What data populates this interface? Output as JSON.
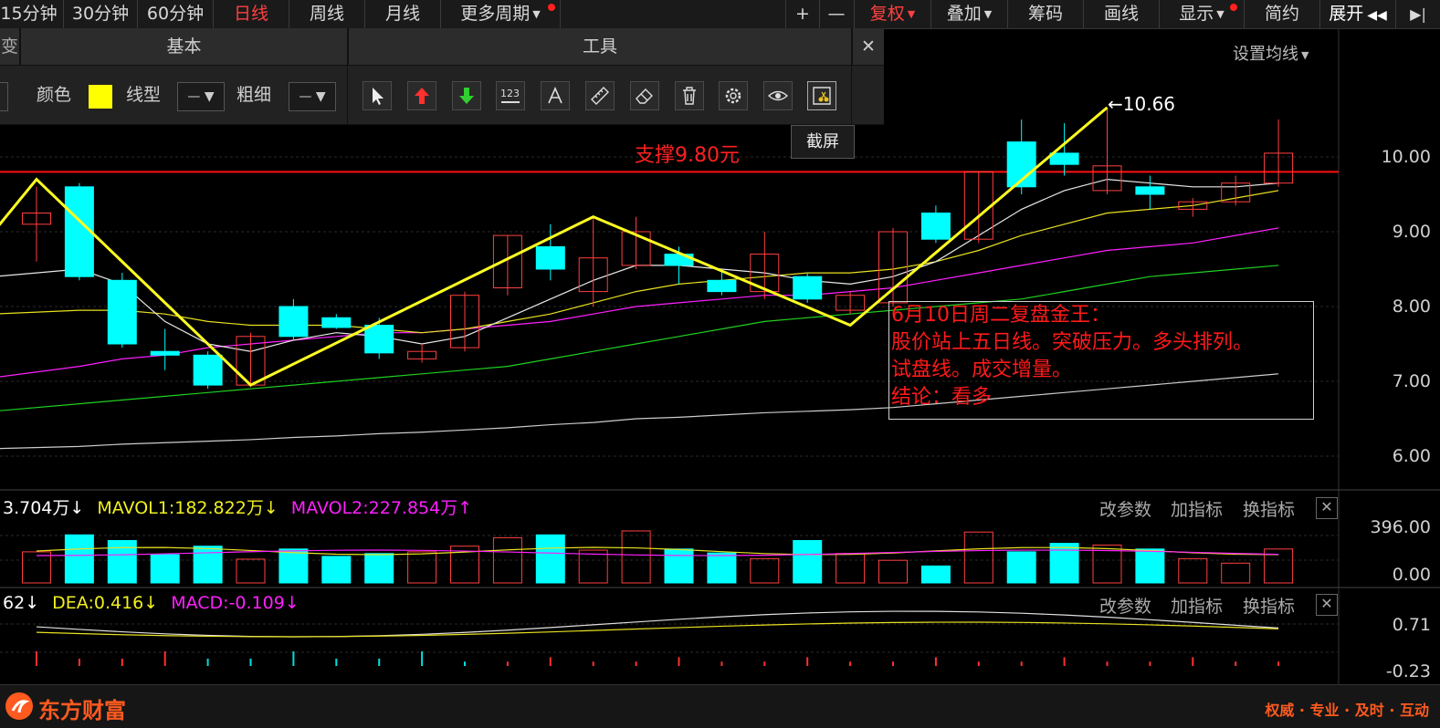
{
  "period_bar": {
    "items": [
      {
        "label": "15分钟",
        "active": false
      },
      {
        "label": "30分钟",
        "active": false
      },
      {
        "label": "60分钟",
        "active": false
      },
      {
        "label": "日线",
        "active": true
      },
      {
        "label": "周线",
        "active": false
      },
      {
        "label": "月线",
        "active": false
      },
      {
        "label": "更多周期",
        "active": false
      }
    ],
    "right_items": [
      {
        "label": "+"
      },
      {
        "label": "—"
      },
      {
        "label": "复权",
        "active": true
      },
      {
        "label": "叠加"
      },
      {
        "label": "筹码"
      },
      {
        "label": "画线"
      },
      {
        "label": "显示"
      },
      {
        "label": "简约"
      },
      {
        "label": "展开"
      }
    ]
  },
  "tool_panel": {
    "left_stub": "变",
    "section_basic": "基本",
    "section_tools": "工具",
    "color_label": "颜色",
    "linetype_label": "线型",
    "thickness_label": "粗细",
    "color_value": "#ffff00",
    "tools": [
      {
        "name": "pointer",
        "tip": ""
      },
      {
        "name": "up-arrow",
        "tip": ""
      },
      {
        "name": "down-arrow",
        "tip": ""
      },
      {
        "name": "number-123",
        "tip": ""
      },
      {
        "name": "text-a",
        "tip": ""
      },
      {
        "name": "ruler",
        "tip": ""
      },
      {
        "name": "eraser",
        "tip": ""
      },
      {
        "name": "trash",
        "tip": ""
      },
      {
        "name": "gear",
        "tip": ""
      },
      {
        "name": "eye",
        "tip": ""
      },
      {
        "name": "screenshot",
        "tip": "截屏"
      }
    ],
    "tooltip": "截屏",
    "close": "✕"
  },
  "main_chart": {
    "setting_label": "设置均线",
    "y_ticks": [
      "10.00",
      "9.00",
      "8.00",
      "7.00",
      "6.00"
    ],
    "support_label": "支撑9.80元",
    "high_label": "10.66",
    "note_lines": [
      "6月10日周二复盘金王：",
      "股价站上五日线。突破压力。多头排列。",
      "试盘线。成交增量。",
      "结论：看多"
    ],
    "colors": {
      "up": "#ff4040",
      "down": "#00ffff",
      "support": "#ff1010",
      "zigzag": "#ffff20"
    }
  },
  "chart_data": {
    "type": "candlestick",
    "y_range": [
      5.6,
      10.9
    ],
    "support_level": 9.8,
    "candles": [
      {
        "o": 9.1,
        "c": 9.25,
        "h": 9.6,
        "l": 8.6,
        "up": true
      },
      {
        "o": 9.6,
        "c": 8.4,
        "h": 9.65,
        "l": 8.35,
        "up": false
      },
      {
        "o": 8.35,
        "c": 7.5,
        "h": 8.45,
        "l": 7.45,
        "up": false
      },
      {
        "o": 7.4,
        "c": 7.35,
        "h": 7.7,
        "l": 7.15,
        "up": false
      },
      {
        "o": 7.35,
        "c": 6.95,
        "h": 7.4,
        "l": 6.9,
        "up": false
      },
      {
        "o": 6.95,
        "c": 7.6,
        "h": 7.65,
        "l": 6.92,
        "up": true
      },
      {
        "o": 8.0,
        "c": 7.6,
        "h": 8.1,
        "l": 7.55,
        "up": false
      },
      {
        "o": 7.85,
        "c": 7.72,
        "h": 7.9,
        "l": 7.7,
        "up": false
      },
      {
        "o": 7.75,
        "c": 7.38,
        "h": 7.85,
        "l": 7.3,
        "up": false
      },
      {
        "o": 7.3,
        "c": 7.4,
        "h": 7.5,
        "l": 7.25,
        "up": true
      },
      {
        "o": 7.45,
        "c": 8.15,
        "h": 8.2,
        "l": 7.4,
        "up": true
      },
      {
        "o": 8.25,
        "c": 8.95,
        "h": 8.95,
        "l": 8.15,
        "up": true
      },
      {
        "o": 8.8,
        "c": 8.5,
        "h": 9.1,
        "l": 8.35,
        "up": false
      },
      {
        "o": 8.2,
        "c": 8.65,
        "h": 9.2,
        "l": 8.0,
        "up": true
      },
      {
        "o": 8.55,
        "c": 9.0,
        "h": 9.2,
        "l": 8.5,
        "up": true
      },
      {
        "o": 8.7,
        "c": 8.55,
        "h": 8.8,
        "l": 8.3,
        "up": false
      },
      {
        "o": 8.35,
        "c": 8.2,
        "h": 8.5,
        "l": 8.15,
        "up": false
      },
      {
        "o": 8.2,
        "c": 8.7,
        "h": 9.0,
        "l": 8.1,
        "up": true
      },
      {
        "o": 8.4,
        "c": 8.1,
        "h": 8.45,
        "l": 8.05,
        "up": false
      },
      {
        "o": 7.95,
        "c": 8.15,
        "h": 8.2,
        "l": 7.9,
        "up": true
      },
      {
        "o": 8.05,
        "c": 9.0,
        "h": 9.05,
        "l": 8.0,
        "up": true
      },
      {
        "o": 9.25,
        "c": 8.9,
        "h": 9.35,
        "l": 8.85,
        "up": false
      },
      {
        "o": 8.9,
        "c": 9.8,
        "h": 9.8,
        "l": 8.85,
        "up": true
      },
      {
        "o": 10.2,
        "c": 9.6,
        "h": 10.5,
        "l": 9.5,
        "up": false
      },
      {
        "o": 10.05,
        "c": 9.9,
        "h": 10.45,
        "l": 9.75,
        "up": false
      },
      {
        "o": 9.55,
        "c": 9.88,
        "h": 10.66,
        "l": 9.5,
        "up": true
      },
      {
        "o": 9.6,
        "c": 9.5,
        "h": 9.75,
        "l": 9.3,
        "up": false
      },
      {
        "o": 9.4,
        "c": 9.3,
        "h": 9.45,
        "l": 9.2,
        "up": true
      },
      {
        "o": 9.4,
        "c": 9.65,
        "h": 9.75,
        "l": 9.35,
        "up": true
      },
      {
        "o": 9.65,
        "c": 10.05,
        "h": 10.5,
        "l": 9.6,
        "up": true
      }
    ],
    "zigzag": [
      [
        -1,
        9.0
      ],
      [
        0,
        9.7
      ],
      [
        5,
        6.95
      ],
      [
        13,
        9.2
      ],
      [
        19,
        7.75
      ],
      [
        25,
        10.66
      ]
    ],
    "ma_white": [
      8.4,
      8.5,
      8.3,
      7.8,
      7.5,
      7.4,
      7.55,
      7.65,
      7.6,
      7.5,
      7.6,
      7.85,
      8.1,
      8.35,
      8.55,
      8.55,
      8.5,
      8.45,
      8.35,
      8.3,
      8.4,
      8.6,
      8.95,
      9.3,
      9.55,
      9.7,
      9.65,
      9.6,
      9.6,
      9.65
    ],
    "ma_yellow": [
      7.9,
      7.95,
      7.95,
      7.9,
      7.8,
      7.75,
      7.75,
      7.75,
      7.7,
      7.65,
      7.7,
      7.8,
      7.9,
      8.05,
      8.2,
      8.3,
      8.35,
      8.4,
      8.45,
      8.45,
      8.5,
      8.6,
      8.75,
      8.95,
      9.1,
      9.25,
      9.3,
      9.35,
      9.45,
      9.55
    ],
    "ma_magenta": [
      7.05,
      7.2,
      7.3,
      7.35,
      7.45,
      7.5,
      7.55,
      7.6,
      7.65,
      7.65,
      7.7,
      7.75,
      7.8,
      7.9,
      8.0,
      8.05,
      8.1,
      8.15,
      8.15,
      8.2,
      8.25,
      8.35,
      8.45,
      8.55,
      8.65,
      8.75,
      8.8,
      8.85,
      8.95,
      9.05
    ],
    "ma_green": [
      6.6,
      6.7,
      6.75,
      6.8,
      6.85,
      6.9,
      6.95,
      7.0,
      7.05,
      7.1,
      7.15,
      7.2,
      7.3,
      7.4,
      7.5,
      7.6,
      7.7,
      7.8,
      7.85,
      7.9,
      7.95,
      8.0,
      8.05,
      8.1,
      8.2,
      8.3,
      8.4,
      8.45,
      8.5,
      8.55
    ],
    "ma_grey": [
      6.1,
      6.13,
      6.16,
      6.18,
      6.2,
      6.22,
      6.25,
      6.27,
      6.3,
      6.32,
      6.35,
      6.38,
      6.42,
      6.45,
      6.5,
      6.52,
      6.55,
      6.58,
      6.6,
      6.62,
      6.65,
      6.7,
      6.75,
      6.8,
      6.85,
      6.9,
      6.95,
      7.0,
      7.05,
      7.1
    ]
  },
  "volume_panel": {
    "vol_label": "3.704万",
    "mavol1_label": "MAVOL1:182.822万",
    "mavol2_label": "MAVOL2:227.854万",
    "arrow_down": "↓",
    "arrow_up": "↑",
    "btn_params": "改参数",
    "btn_add": "加指标",
    "btn_swap": "换指标",
    "close": "✕",
    "y_ticks": [
      "396.00",
      "0.00"
    ],
    "bars": [
      0.55,
      0.85,
      0.75,
      0.5,
      0.65,
      0.42,
      0.6,
      0.47,
      0.52,
      0.55,
      0.65,
      0.8,
      0.85,
      0.58,
      0.92,
      0.6,
      0.53,
      0.43,
      0.75,
      0.52,
      0.4,
      0.3,
      0.9,
      0.55,
      0.7,
      0.67,
      0.6,
      0.43,
      0.35,
      0.6
    ]
  },
  "macd_panel": {
    "diff_label": "62",
    "dea_label": "DEA:0.416",
    "macd_label": "MACD:-0.109",
    "arrow_down": "↓",
    "btn_params": "改参数",
    "btn_add": "加指标",
    "btn_swap": "换指标",
    "close": "✕",
    "y_ticks": [
      "0.71",
      "-0.23"
    ]
  },
  "bottom_bar": {
    "logo_text": "东方财富",
    "slogan": "权威 · 专业 · 及时 · 互动"
  }
}
